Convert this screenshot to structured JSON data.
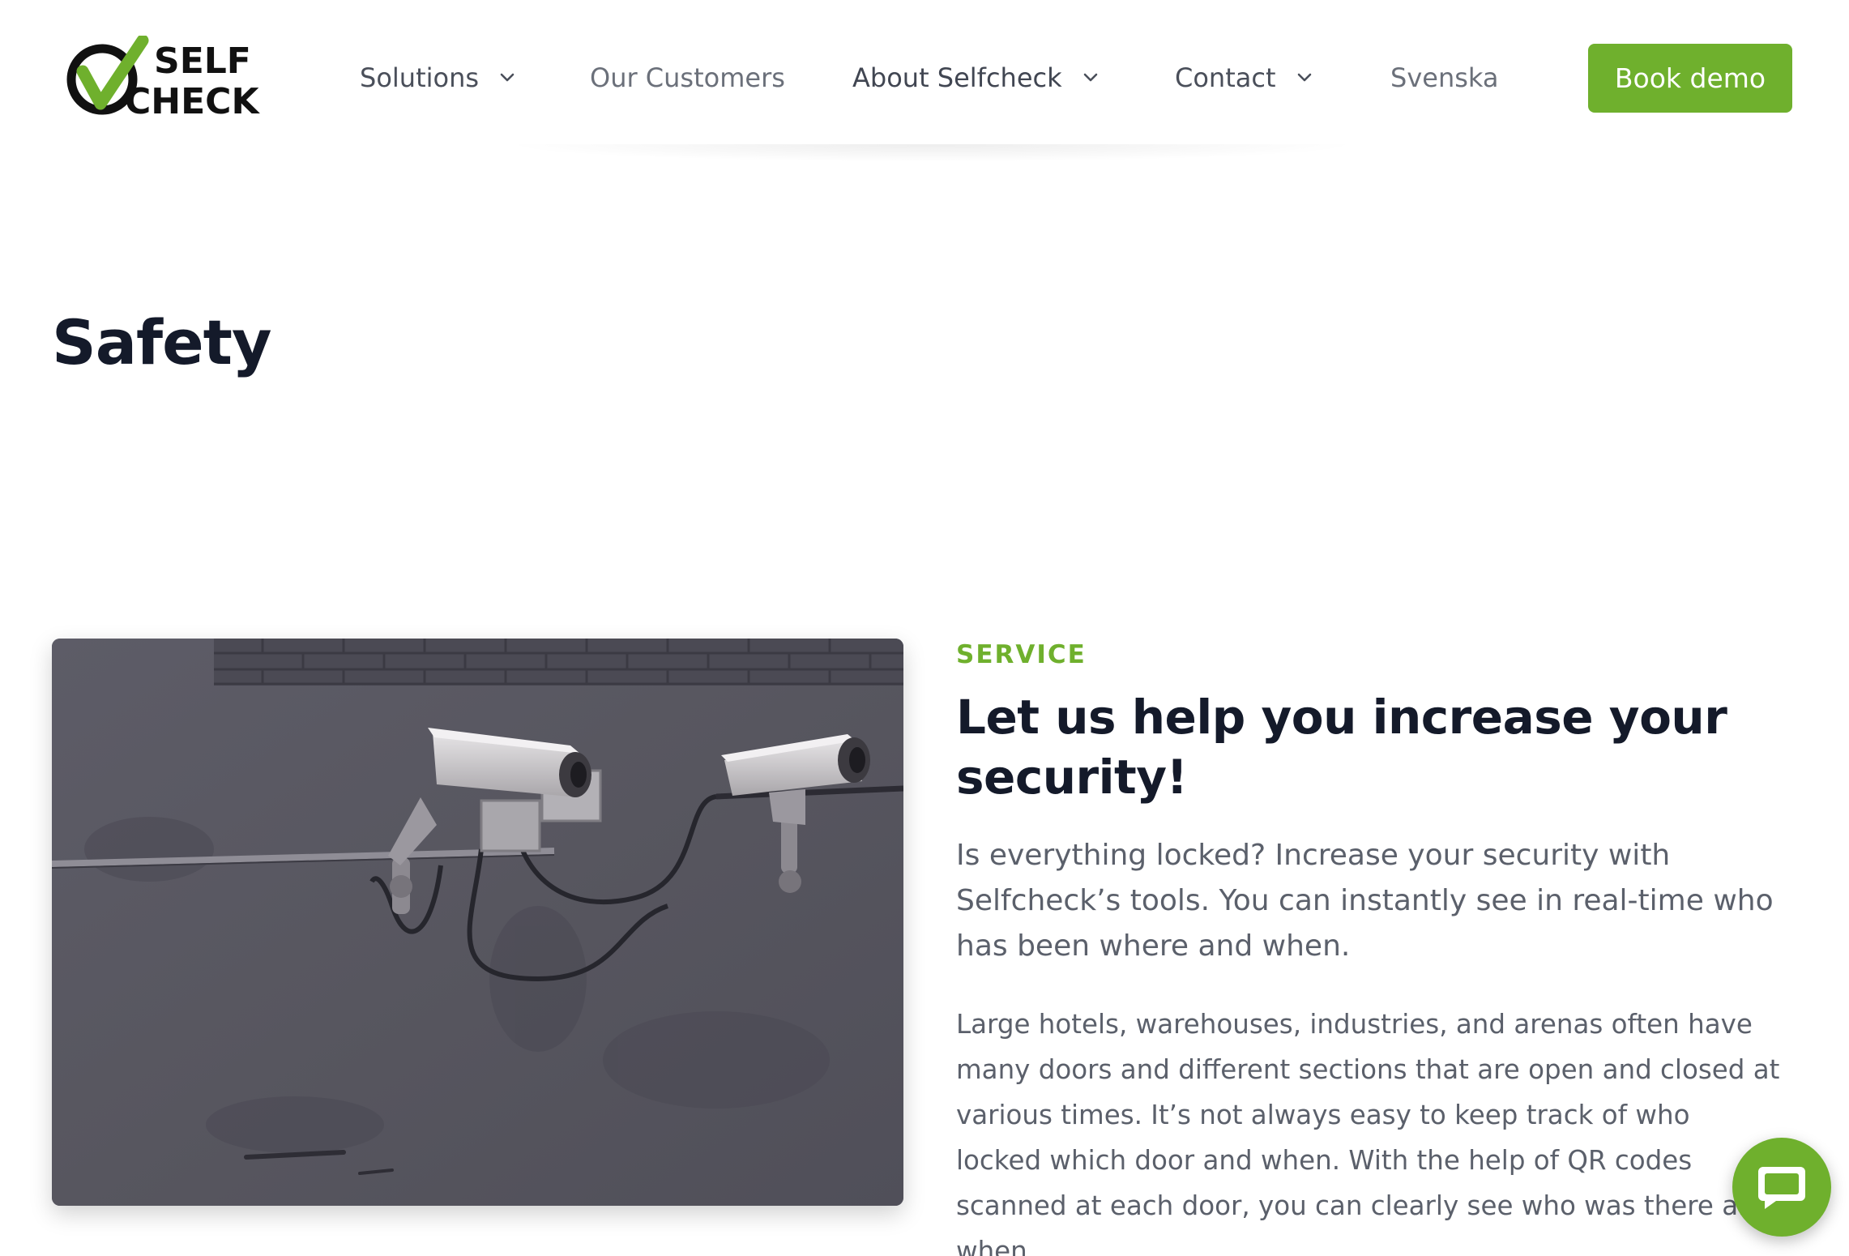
{
  "header": {
    "logo": {
      "line1": "SELF",
      "line2": "CHECK",
      "brand_color": "#6fb02d",
      "ink_color": "#111111"
    },
    "nav": [
      {
        "label": "Solutions",
        "has_dropdown": true
      },
      {
        "label": "Our Customers",
        "has_dropdown": false
      },
      {
        "label": "About Selfcheck",
        "has_dropdown": true
      },
      {
        "label": "Contact",
        "has_dropdown": true
      },
      {
        "label": "Svenska",
        "has_dropdown": false
      }
    ],
    "cta_label": "Book demo"
  },
  "page": {
    "title": "Safety"
  },
  "section": {
    "eyebrow": "SERVICE",
    "headline": "Let us help you increase your security!",
    "lead": "Is everything locked? Increase your security with Selfcheck’s tools. You can instantly see in real-time who has been where and when.",
    "body": "Large hotels, warehouses, industries, and arenas often have many doors and different sections that are open and closed at various times. It’s not always easy to keep track of who locked which door and when. With the help of QR codes scanned at each door, you can clearly see who was there and when.",
    "image_subject": "security-cameras-on-wall"
  },
  "chat": {
    "icon": "chat-bubble-icon"
  },
  "colors": {
    "accent": "#6fb02d",
    "heading": "#141a2a",
    "text": "#5b606b"
  }
}
